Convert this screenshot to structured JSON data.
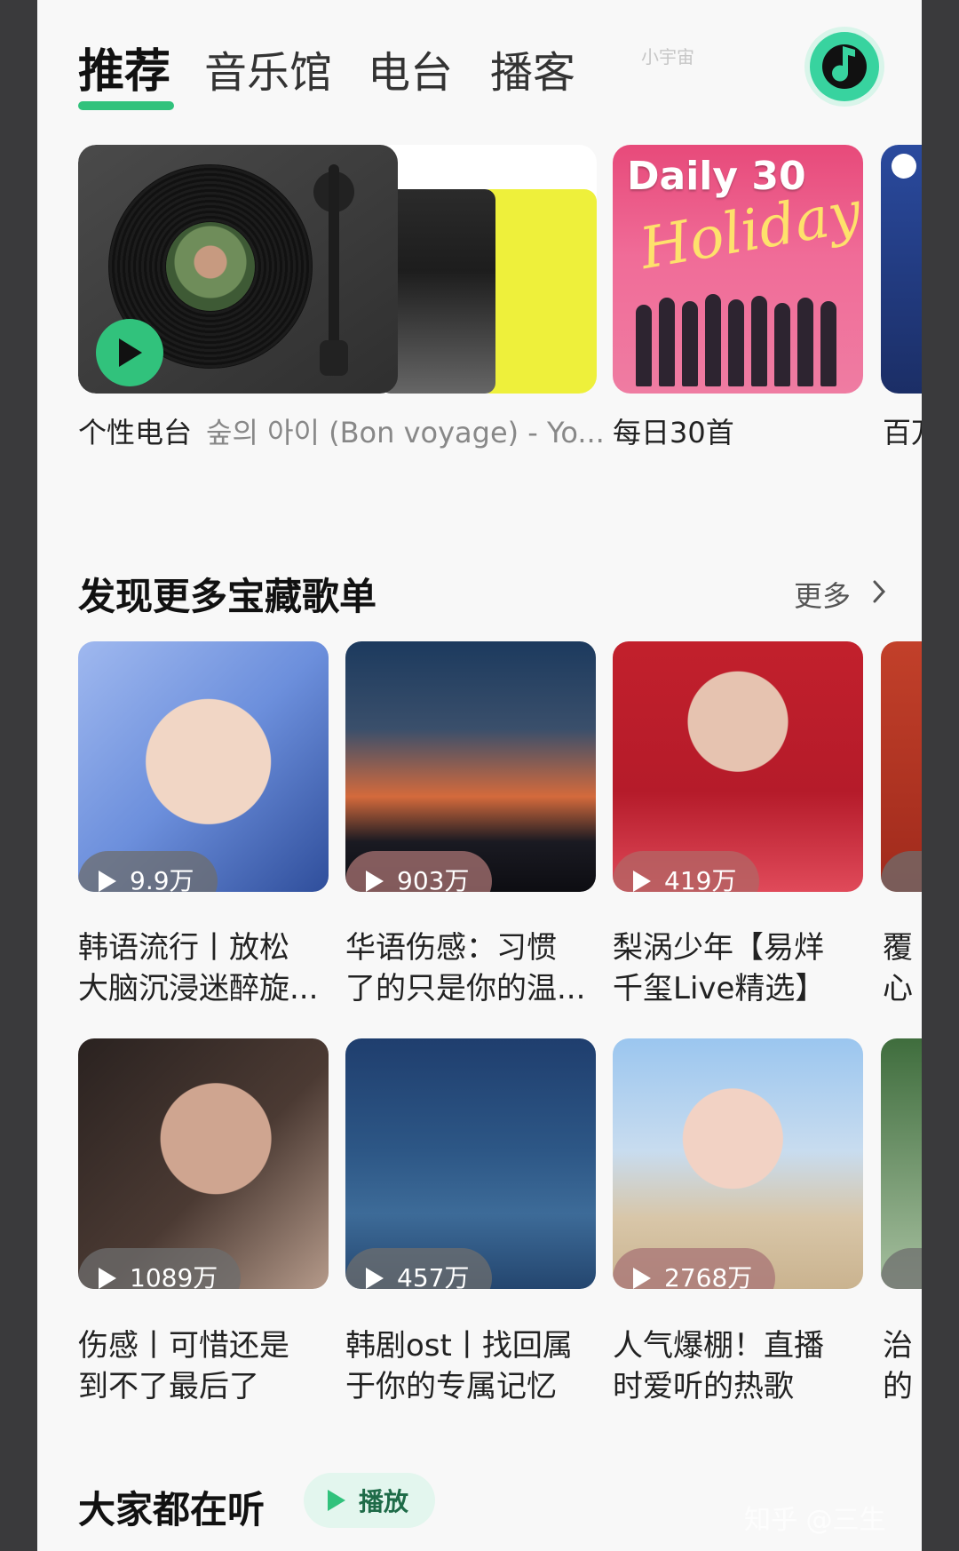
{
  "tabs": [
    {
      "label": "推荐",
      "active": true
    },
    {
      "label": "音乐馆",
      "active": false
    },
    {
      "label": "电台",
      "active": false
    },
    {
      "label": "播客",
      "active": false
    }
  ],
  "tab_badge": "小宇宙",
  "colors": {
    "accent": "#31c27c",
    "brand_dark": "#111111"
  },
  "icons": {
    "music": "music-note-icon",
    "play": "play-icon",
    "chevron": "chevron-right-icon"
  },
  "featured": {
    "radio": {
      "label": "个性电台",
      "now_playing": "숲의 아이 (Bon voyage) - Yo..."
    },
    "daily": {
      "label": "每日30首",
      "cover_text": "Daily 30",
      "cover_script": "Holiday"
    },
    "peek_label": "百万"
  },
  "discover": {
    "title": "发现更多宝藏歌单",
    "more": "更多",
    "playlists": [
      {
        "count": "9.9万",
        "title_line1": "韩语流行丨放松",
        "title_line2": "大脑沉浸迷醉旋..."
      },
      {
        "count": "903万",
        "title_line1": "华语伤感：习惯",
        "title_line2": "了的只是你的温..."
      },
      {
        "count": "419万",
        "title_line1": "梨涡少年【易烊",
        "title_line2": "千玺Live精选】"
      },
      {
        "count": "1089万",
        "title_line1": "伤感丨可惜还是",
        "title_line2": "到不了最后了"
      },
      {
        "count": "457万",
        "title_line1": "韩剧ost丨找回属",
        "title_line2": "于你的专属记忆"
      },
      {
        "count": "2768万",
        "title_line1": "人气爆棚！直播",
        "title_line2": "时爱听的热歌"
      }
    ],
    "peek_titles": [
      {
        "line1": "覆",
        "line2": "心"
      },
      {
        "line1": "治",
        "line2": "的"
      }
    ]
  },
  "bottom": {
    "title": "大家都在听",
    "play_label": "播放"
  },
  "watermark": "知乎 @三生"
}
